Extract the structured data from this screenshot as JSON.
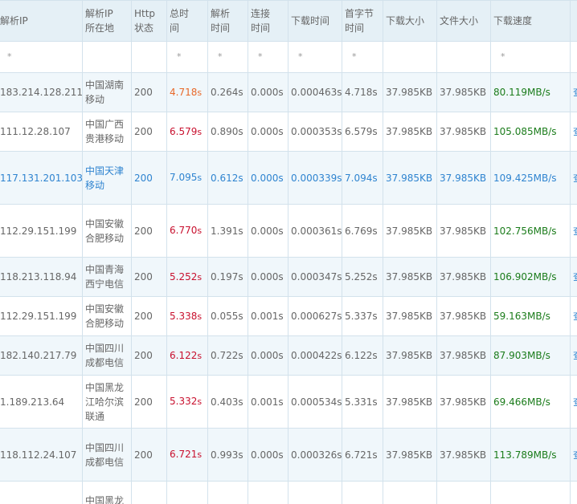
{
  "headers": {
    "ip": "解析IP",
    "loc_l1": "解析IP",
    "loc_l2": "所在地",
    "http_l1": "Http",
    "http_l2": "状态",
    "total_l1": "总时",
    "total_l2": "间",
    "resolve_l1": "解析",
    "resolve_l2": "时间",
    "connect_l1": "连接",
    "connect_l2": "时间",
    "download_time": "下载时间",
    "first_l1": "首字节",
    "first_l2": "时间",
    "download_size": "下载大小",
    "file_size": "文件大小",
    "download_speed": "下载速度"
  },
  "filter_placeholder": "*",
  "unit_s": "s",
  "action_label": "查看",
  "rows": [
    {
      "ip": "183.214.128.211",
      "loc": "中国湖南移动",
      "http": "200",
      "total": "4.718",
      "resolve": "0.264s",
      "connect": "0.000s",
      "dl": "0.000463s",
      "first": "4.718s",
      "size": "37.985KB",
      "fsize": "37.985KB",
      "speed": "80.119MB/s"
    },
    {
      "ip": "111.12.28.107",
      "loc": "中国广西贵港移动",
      "http": "200",
      "total": "6.579",
      "resolve": "0.890s",
      "connect": "0.000s",
      "dl": "0.000353s",
      "first": "6.579s",
      "size": "37.985KB",
      "fsize": "37.985KB",
      "speed": "105.085MB/s"
    },
    {
      "ip": "117.131.201.103",
      "loc": "中国天津移动",
      "http": "200",
      "total": "7.095",
      "resolve": "0.612s",
      "connect": "0.000s",
      "dl": "0.000339s",
      "first": "7.094s",
      "size": "37.985KB",
      "fsize": "37.985KB",
      "speed": "109.425MB/s"
    },
    {
      "ip": "112.29.151.199",
      "loc": "中国安徽合肥移动",
      "http": "200",
      "total": "6.770",
      "resolve": "1.391s",
      "connect": "0.000s",
      "dl": "0.000361s",
      "first": "6.769s",
      "size": "37.985KB",
      "fsize": "37.985KB",
      "speed": "102.756MB/s"
    },
    {
      "ip": "118.213.118.94",
      "loc": "中国青海西宁电信",
      "http": "200",
      "total": "5.252",
      "resolve": "0.197s",
      "connect": "0.000s",
      "dl": "0.000347s",
      "first": "5.252s",
      "size": "37.985KB",
      "fsize": "37.985KB",
      "speed": "106.902MB/s"
    },
    {
      "ip": "112.29.151.199",
      "loc": "中国安徽合肥移动",
      "http": "200",
      "total": "5.338",
      "resolve": "0.055s",
      "connect": "0.001s",
      "dl": "0.000627s",
      "first": "5.337s",
      "size": "37.985KB",
      "fsize": "37.985KB",
      "speed": "59.163MB/s"
    },
    {
      "ip": "182.140.217.79",
      "loc": "中国四川成都电信",
      "http": "200",
      "total": "6.122",
      "resolve": "0.722s",
      "connect": "0.000s",
      "dl": "0.000422s",
      "first": "6.122s",
      "size": "37.985KB",
      "fsize": "37.985KB",
      "speed": "87.903MB/s"
    },
    {
      "ip": "1.189.213.64",
      "loc": "中国黑龙江哈尔滨联通",
      "http": "200",
      "total": "5.332",
      "resolve": "0.403s",
      "connect": "0.001s",
      "dl": "0.000534s",
      "first": "5.331s",
      "size": "37.985KB",
      "fsize": "37.985KB",
      "speed": "69.466MB/s"
    },
    {
      "ip": "118.112.24.107",
      "loc": "中国四川成都电信",
      "http": "200",
      "total": "6.721",
      "resolve": "0.993s",
      "connect": "0.000s",
      "dl": "0.000326s",
      "first": "6.721s",
      "size": "37.985KB",
      "fsize": "37.985KB",
      "speed": "113.789MB/s"
    },
    {
      "ip": "",
      "loc": "中国黑龙",
      "http": "",
      "total": "",
      "resolve": "",
      "connect": "",
      "dl": "",
      "first": "",
      "size": "",
      "fsize": "",
      "speed": ""
    }
  ]
}
